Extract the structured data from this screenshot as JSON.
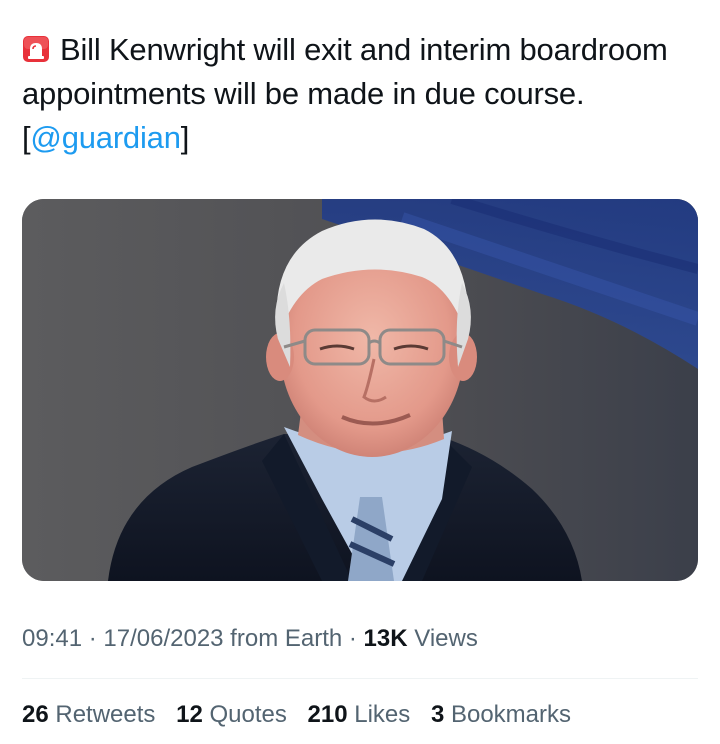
{
  "tweet": {
    "icon": "siren-icon",
    "text_before_mention": "Bill Kenwright will exit and interim boardroom appointments will be made in due course. [",
    "mention": "@guardian",
    "text_after_mention": "]"
  },
  "media": {
    "subject": "photo of an older man with white hair and glasses in a navy suit, light blue shirt and striped tie, in a stadium stand"
  },
  "meta": {
    "time": "09:41",
    "separator1": " · ",
    "date": "17/06/2023",
    "source": " from Earth",
    "separator2": " · ",
    "views_count": "13K",
    "views_label": " Views"
  },
  "stats": {
    "retweets": {
      "count": "26",
      "label": " Retweets"
    },
    "quotes": {
      "count": "12",
      "label": " Quotes"
    },
    "likes": {
      "count": "210",
      "label": " Likes"
    },
    "bookmarks": {
      "count": "3",
      "label": " Bookmarks"
    }
  },
  "colors": {
    "text": "#0f1419",
    "secondary": "#536471",
    "link": "#1d9bf0",
    "siren": "#e8313a"
  }
}
